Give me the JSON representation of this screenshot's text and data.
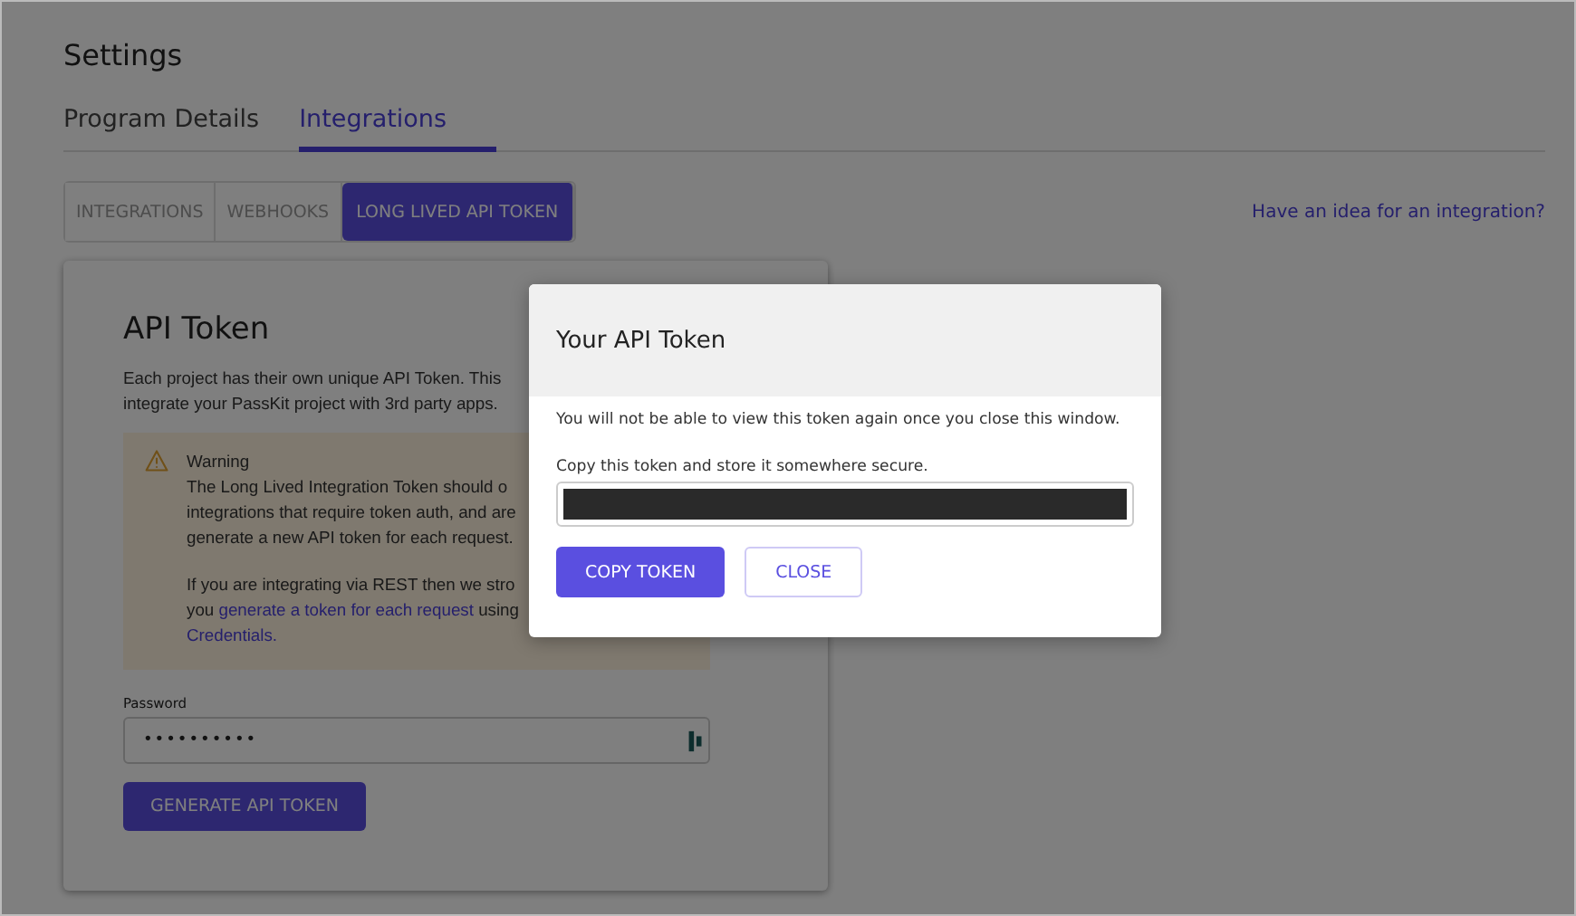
{
  "page": {
    "title": "Settings"
  },
  "tabs": [
    {
      "label": "Program Details",
      "selected": false
    },
    {
      "label": "Integrations",
      "selected": true
    }
  ],
  "subtabs": [
    {
      "label": "INTEGRATIONS",
      "selected": false
    },
    {
      "label": "WEBHOOKS",
      "selected": false
    },
    {
      "label": "LONG LIVED API TOKEN",
      "selected": true
    }
  ],
  "idea_link": "Have an idea for an integration?",
  "card": {
    "title": "API Token",
    "intro_lines": [
      "Each project has their own unique API Token. This",
      "integrate your PassKit project with 3rd party apps."
    ],
    "warning": {
      "title": "Warning",
      "lines": [
        "The Long Lived Integration Token should o",
        "integrations that require token auth, and are",
        "generate a new API token for each request."
      ],
      "rest_line": "If you are integrating via REST then we stro",
      "link_prefix": "you ",
      "link": "generate a token for each request",
      "link_suffix": " using",
      "credentials_link": "Credentials."
    },
    "password": {
      "label": "Password",
      "value": "••••••••••"
    },
    "generate_button": "GENERATE API TOKEN"
  },
  "modal": {
    "title": "Your API Token",
    "notice": "You will not be able to view this token again once you close this window.",
    "copy_label": "Copy this token and store it somewhere secure.",
    "buttons": [
      {
        "label": "COPY TOKEN",
        "kind": "primary"
      },
      {
        "label": "CLOSE",
        "kind": "outline"
      }
    ]
  }
}
